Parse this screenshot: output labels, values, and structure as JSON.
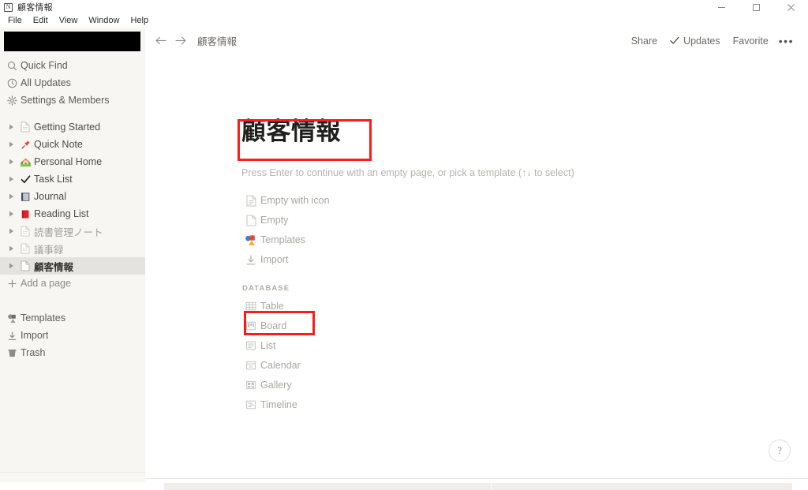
{
  "window": {
    "app_icon": "notion-app-icon",
    "title": "顧客情報",
    "controls": {
      "minimize": "minimize-icon",
      "maximize": "maximize-icon",
      "close": "close-icon"
    }
  },
  "menubar": {
    "items": [
      {
        "label": "File"
      },
      {
        "label": "Edit"
      },
      {
        "label": "View"
      },
      {
        "label": "Window"
      },
      {
        "label": "Help"
      }
    ]
  },
  "sidebar": {
    "workspace": {
      "redacted": true
    },
    "nav": [
      {
        "label": "Quick Find",
        "icon": "search-icon"
      },
      {
        "label": "All Updates",
        "icon": "clock-icon"
      },
      {
        "label": "Settings & Members",
        "icon": "gear-icon"
      }
    ],
    "pages": [
      {
        "label": "Getting Started",
        "emoji": "blank-page-icon",
        "dim": false,
        "selected": false
      },
      {
        "label": "Quick Note",
        "emoji": "pushpin-emoji",
        "dim": false,
        "selected": false
      },
      {
        "label": "Personal Home",
        "emoji": "house-with-garden-emoji",
        "dim": false,
        "selected": false
      },
      {
        "label": "Task List",
        "emoji": "check-mark-emoji",
        "dim": false,
        "selected": false
      },
      {
        "label": "Journal",
        "emoji": "notebook-emoji",
        "dim": false,
        "selected": false
      },
      {
        "label": "Reading List",
        "emoji": "closed-book-emoji",
        "dim": false,
        "selected": false
      },
      {
        "label": "読書管理ノート",
        "emoji": "blank-page-icon",
        "dim": true,
        "selected": false
      },
      {
        "label": "議事録",
        "emoji": "blank-page-icon",
        "dim": true,
        "selected": false
      },
      {
        "label": "顧客情報",
        "emoji": "blank-page-icon",
        "dim": false,
        "selected": true
      }
    ],
    "add_page": {
      "label": "Add a page",
      "icon": "plus-icon"
    },
    "bottom": [
      {
        "label": "Templates",
        "icon": "templates-icon"
      },
      {
        "label": "Import",
        "icon": "import-icon"
      },
      {
        "label": "Trash",
        "icon": "trash-icon"
      }
    ]
  },
  "topbar": {
    "back_icon": "arrow-left-icon",
    "forward_icon": "arrow-right-icon",
    "breadcrumb": "顧客情報",
    "actions": [
      {
        "label": "Share",
        "icon": ""
      },
      {
        "label": "Updates",
        "icon": "check-icon"
      },
      {
        "label": "Favorite",
        "icon": ""
      }
    ],
    "more_label": "•••"
  },
  "page": {
    "title": "顧客情報",
    "hint": "Press Enter to continue with an empty page, or pick a template (↑↓ to select)",
    "options": [
      {
        "label": "Empty with icon",
        "icon": "page-with-icon-icon"
      },
      {
        "label": "Empty",
        "icon": "blank-page-icon"
      },
      {
        "label": "Templates",
        "icon": "templates-shapes-icon"
      },
      {
        "label": "Import",
        "icon": "import-arrow-icon"
      }
    ],
    "database_section_label": "DATABASE",
    "database_options": [
      {
        "label": "Table",
        "icon": "table-icon",
        "highlighted": true
      },
      {
        "label": "Board",
        "icon": "board-icon",
        "highlighted": false
      },
      {
        "label": "List",
        "icon": "list-icon",
        "highlighted": false
      },
      {
        "label": "Calendar",
        "icon": "calendar-icon",
        "highlighted": false
      },
      {
        "label": "Gallery",
        "icon": "gallery-icon",
        "highlighted": false
      },
      {
        "label": "Timeline",
        "icon": "timeline-icon",
        "highlighted": false
      }
    ]
  },
  "help_button": {
    "label": "?",
    "icon": "question-mark-icon"
  },
  "annotations": {
    "color": "#fc1c1c",
    "boxes": [
      {
        "target": "page-title"
      },
      {
        "target": "database-option-table"
      }
    ]
  }
}
